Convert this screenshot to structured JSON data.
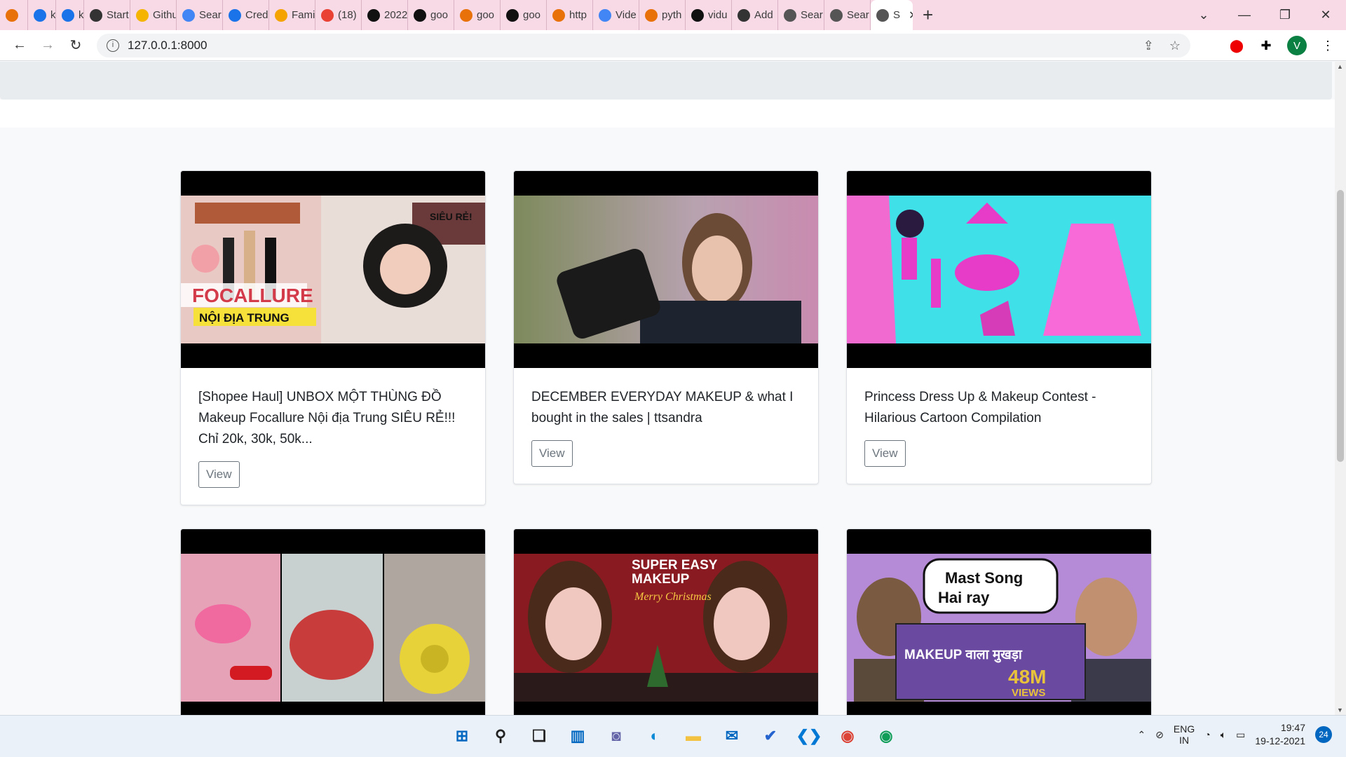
{
  "browser": {
    "tabs": [
      {
        "label": "",
        "icon": "chrome-logo-icon",
        "color": "#e8710a"
      },
      {
        "label": "k",
        "icon": "k-icon",
        "color": "#1a73e8"
      },
      {
        "label": "k",
        "icon": "k-icon",
        "color": "#1a73e8"
      },
      {
        "label": "Start",
        "icon": "peace-icon",
        "color": "#333333"
      },
      {
        "label": "Githu",
        "icon": "bulb-icon",
        "color": "#f4b400"
      },
      {
        "label": "Sear",
        "icon": "code-icon",
        "color": "#4285f4"
      },
      {
        "label": "Cred",
        "icon": "api-icon",
        "color": "#1a73e8"
      },
      {
        "label": "Fami",
        "icon": "heart-icon",
        "color": "#f4a300"
      },
      {
        "label": "(18)",
        "icon": "c-icon",
        "color": "#e94235"
      },
      {
        "label": "2022",
        "icon": "dot-icon",
        "color": "#111111"
      },
      {
        "label": "goo",
        "icon": "github-icon",
        "color": "#111111"
      },
      {
        "label": "goo",
        "icon": "colab-icon",
        "color": "#e8710a"
      },
      {
        "label": "goo",
        "icon": "github-icon",
        "color": "#111111"
      },
      {
        "label": "http",
        "icon": "colab-icon",
        "color": "#e8710a"
      },
      {
        "label": "Vide",
        "icon": "code-icon",
        "color": "#4285f4"
      },
      {
        "label": "pyth",
        "icon": "python-icon",
        "color": "#e8710a"
      },
      {
        "label": "vidu",
        "icon": "github-icon",
        "color": "#111111"
      },
      {
        "label": "Add",
        "icon": "add-icon",
        "color": "#333333"
      },
      {
        "label": "Sear",
        "icon": "globe-icon",
        "color": "#555555"
      },
      {
        "label": "Sear",
        "icon": "globe-icon",
        "color": "#555555"
      },
      {
        "label": "S",
        "icon": "globe-icon",
        "color": "#555555",
        "active": true
      }
    ],
    "url": "127.0.0.1:8000",
    "avatar_letter": "V"
  },
  "cards": [
    {
      "title": "[Shopee Haul] UNBOX MỘT THÙNG ĐỒ Makeup Focallure Nội địa Trung SIÊU RẺ!!! Chỉ 20k, 30k, 50k...",
      "view_label": "View",
      "thumb_colors": [
        "#e9c9c4",
        "#d33b4a",
        "#2b2b2b"
      ]
    },
    {
      "title": "DECEMBER EVERYDAY MAKEUP & what I bought in the sales | ttsandra",
      "view_label": "View",
      "thumb_colors": [
        "#7d8a5c",
        "#c98bb0",
        "#1d2430"
      ]
    },
    {
      "title": "Princess Dress Up & Makeup Contest - Hilarious Cartoon Compilation",
      "view_label": "View",
      "thumb_colors": [
        "#40e0e8",
        "#e63cc8",
        "#f86ad8"
      ]
    },
    {
      "title": "",
      "view_label": "",
      "thumb_colors": [
        "#e6a3b8",
        "#c83c3c",
        "#e8d23a"
      ]
    },
    {
      "title": "",
      "view_label": "",
      "thumb_colors": [
        "#8a1a22",
        "#f0c8c0",
        "#2a1a1a"
      ],
      "overlay": "SUPER EASY MAKEUP Merry Christmas"
    },
    {
      "title": "",
      "view_label": "",
      "thumb_colors": [
        "#b58ad6",
        "#6a4aa0",
        "#e8c23a"
      ],
      "overlay": "Mast Song Hai ray",
      "overlay2": "MAKEUP वाला मुखड़ा 48M VIEWS"
    }
  ],
  "taskbar": {
    "apps": [
      "windows-start-icon",
      "search-icon",
      "task-view-icon",
      "widgets-icon",
      "teams-chat-icon",
      "edge-icon",
      "file-explorer-icon",
      "mail-icon",
      "todo-icon",
      "vscode-icon",
      "chrome-icon",
      "chrome-alt-icon"
    ],
    "lang_line1": "ENG",
    "lang_line2": "IN",
    "time": "19:47",
    "date": "19-12-2021",
    "notification_count": "24"
  }
}
